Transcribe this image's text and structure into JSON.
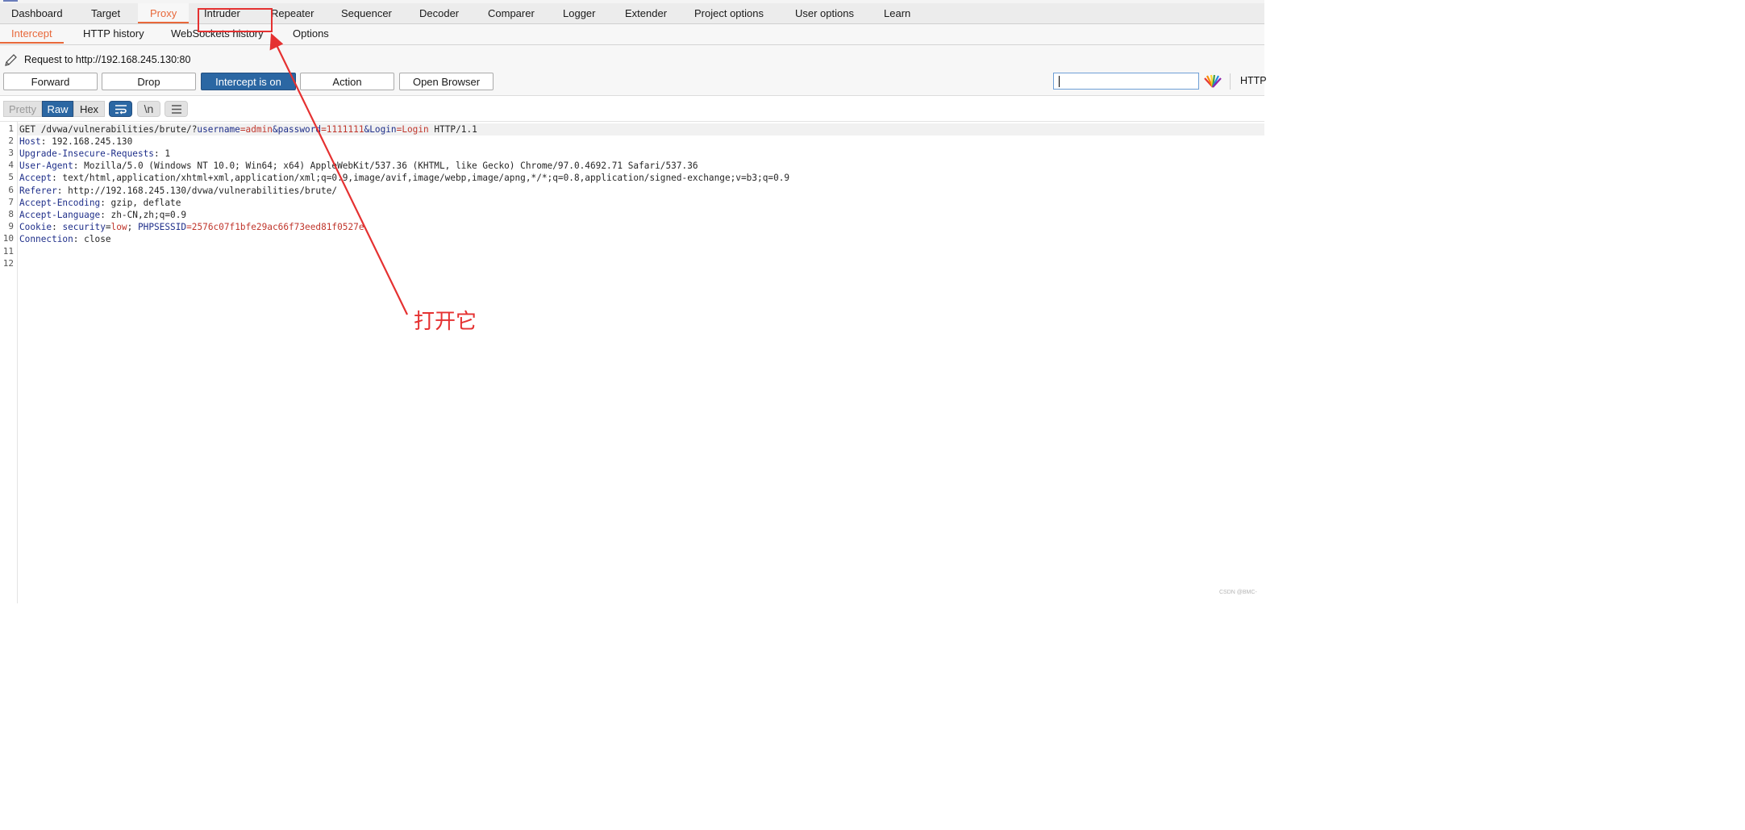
{
  "main_tabs": [
    "Dashboard",
    "Target",
    "Proxy",
    "Intruder",
    "Repeater",
    "Sequencer",
    "Decoder",
    "Comparer",
    "Logger",
    "Extender",
    "Project options",
    "User options",
    "Learn"
  ],
  "proxy_subtabs": [
    "Intercept",
    "HTTP history",
    "WebSockets history",
    "Options"
  ],
  "intercept": {
    "request_label": "Request to http://192.168.245.130:80",
    "buttons": {
      "forward": "Forward",
      "drop": "Drop",
      "intercept": "Intercept is on",
      "action": "Action",
      "open_browser": "Open Browser"
    },
    "search_value": "",
    "http_label": "HTTP"
  },
  "view_modes": {
    "pretty": "Pretty",
    "raw": "Raw",
    "hex": "Hex",
    "newline": "\\n"
  },
  "request": {
    "line_numbers": [
      "1",
      "2",
      "3",
      "4",
      "5",
      "6",
      "7",
      "8",
      "9",
      "10",
      "11",
      "12"
    ],
    "l1": {
      "method_path": "GET /dvwa/vulnerabilities/brute/?",
      "p1": "username",
      "eq1": "=",
      "v1": "admin",
      "amp1": "&",
      "p2": "password",
      "eq2": "=",
      "v2": "1111111",
      "amp2": "&",
      "p3": "Login",
      "eq3": "=",
      "v3": "Login",
      "proto": " HTTP/1.1"
    },
    "l2": {
      "key": "Host",
      "rest": ": 192.168.245.130"
    },
    "l3": {
      "key": "Upgrade-Insecure-Requests",
      "rest": ": 1"
    },
    "l4": {
      "key": "User-Agent",
      "rest": ": Mozilla/5.0 (Windows NT 10.0; Win64; x64) AppleWebKit/537.36 (KHTML, like Gecko) Chrome/97.0.4692.71 Safari/537.36"
    },
    "l5": {
      "key": "Accept",
      "rest": ": text/html,application/xhtml+xml,application/xml;q=0.9,image/avif,image/webp,image/apng,*/*;q=0.8,application/signed-exchange;v=b3;q=0.9"
    },
    "l6": {
      "key": "Referer",
      "rest": ": http://192.168.245.130/dvwa/vulnerabilities/brute/"
    },
    "l7": {
      "key": "Accept-Encoding",
      "rest": ": gzip, deflate"
    },
    "l8": {
      "key": "Accept-Language",
      "rest": ": zh-CN,zh;q=0.9"
    },
    "l9": {
      "key": "Cookie",
      "sep": ": ",
      "c1n": "security",
      "eq1": "=",
      "c1v": "low",
      "semi": "; ",
      "c2n": "PHPSESSID",
      "eq2": "=",
      "c2v": "2576c07f1bfe29ac66f73eed81f0527e"
    },
    "l10": {
      "key": "Connection",
      "rest": ": close"
    }
  },
  "annotation": {
    "text": "打开它",
    "color": "#e53131"
  },
  "watermark": "CSDN @BMC-",
  "colors": {
    "accent_orange": "#e8683a",
    "button_blue": "#2b67a3",
    "header_key": "#1f2f8a",
    "param_value": "#c0362c"
  }
}
